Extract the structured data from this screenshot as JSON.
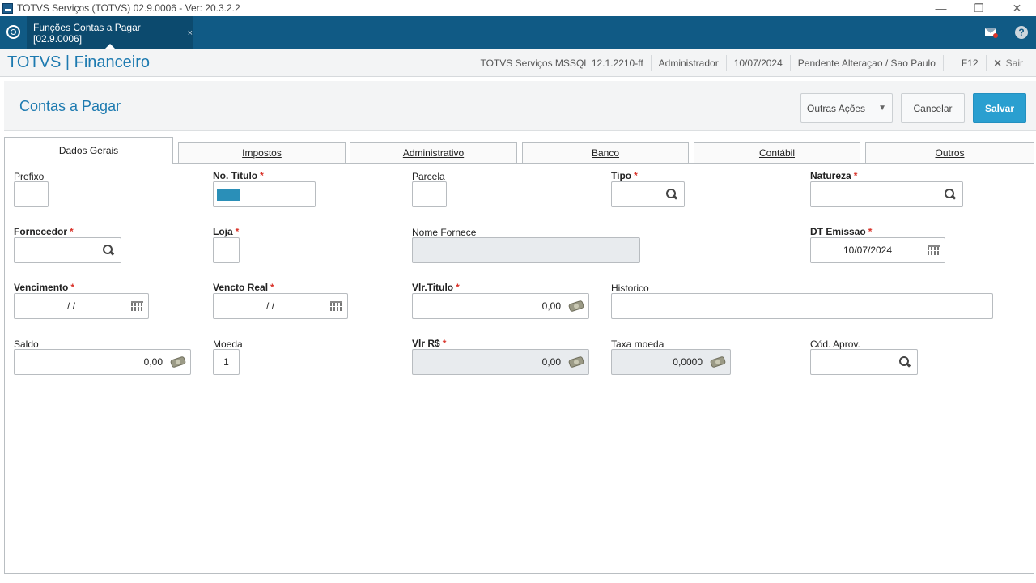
{
  "window": {
    "title": "TOTVS Serviços (TOTVS) 02.9.0006 - Ver: 20.3.2.2",
    "controls": {
      "minimize": "—",
      "restore": "❐",
      "close": "✕"
    }
  },
  "tabstrip": {
    "active_tab": "Funções Contas a Pagar [02.9.0006]",
    "close_glyph": "×",
    "help_glyph": "?"
  },
  "header": {
    "brand": "TOTVS | Financeiro",
    "environment": "TOTVS Serviços MSSQL 12.1.2210-ff",
    "user": "Administrador",
    "date": "10/07/2024",
    "branch": "Pendente Alteraçao / Sao Paulo",
    "shortcut": "F12",
    "exit_label": "Sair",
    "exit_glyph": "✕"
  },
  "page": {
    "title": "Contas a Pagar",
    "actions": {
      "more": "Outras Ações",
      "more_caret": "▼",
      "cancel": "Cancelar",
      "save": "Salvar"
    }
  },
  "tabs": [
    "Dados Gerais",
    "Impostos",
    "Administrativo",
    "Banco",
    "Contábil",
    "Outros"
  ],
  "fields": {
    "prefixo": {
      "label": "Prefixo",
      "value": ""
    },
    "no_titulo": {
      "label": "No. Titulo",
      "value": ""
    },
    "parcela": {
      "label": "Parcela",
      "value": ""
    },
    "tipo": {
      "label": "Tipo",
      "value": ""
    },
    "natureza": {
      "label": "Natureza",
      "value": ""
    },
    "fornecedor": {
      "label": "Fornecedor",
      "value": ""
    },
    "loja": {
      "label": "Loja",
      "value": ""
    },
    "nome_fornece": {
      "label": "Nome Fornece",
      "value": ""
    },
    "dt_emissao": {
      "label": "DT Emissao",
      "value": "10/07/2024"
    },
    "vencimento": {
      "label": "Vencimento",
      "value": "/ /"
    },
    "vencto_real": {
      "label": "Vencto Real",
      "value": "/ /"
    },
    "vlr_titulo": {
      "label": "Vlr.Titulo",
      "value": "0,00"
    },
    "historico": {
      "label": "Historico",
      "value": ""
    },
    "saldo": {
      "label": "Saldo",
      "value": "0,00"
    },
    "moeda": {
      "label": "Moeda",
      "value": "1"
    },
    "vlr_rs": {
      "label": "Vlr R$",
      "value": "0,00"
    },
    "taxa_moeda": {
      "label": "Taxa moeda",
      "value": "0,0000"
    },
    "cod_aprov": {
      "label": "Cód. Aprov.",
      "value": ""
    }
  },
  "required_marker": "*",
  "colors": {
    "brand_blue": "#1d7ab0",
    "tabstrip": "#105a85",
    "save_button": "#2a9fd0",
    "required": "#d9342b"
  }
}
